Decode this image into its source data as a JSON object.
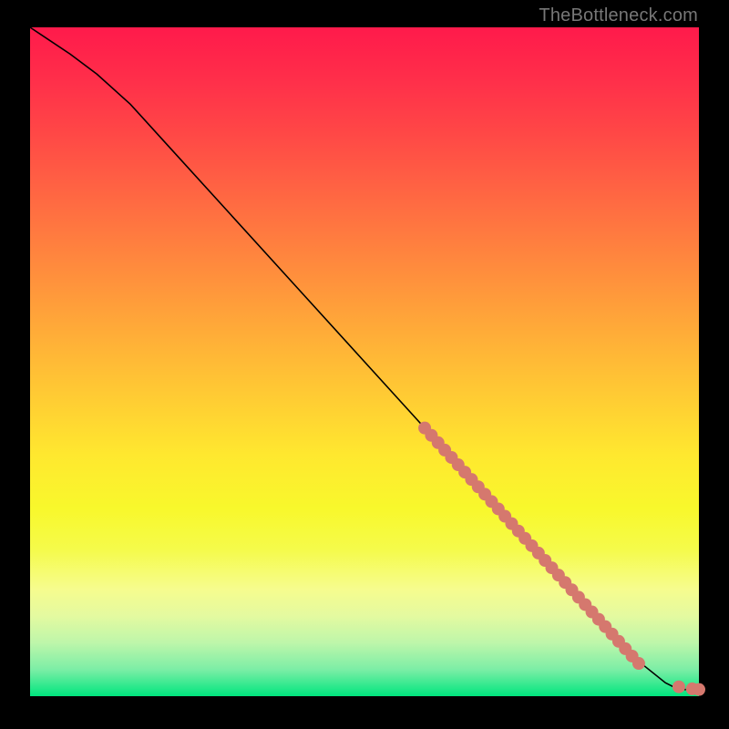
{
  "attribution": "TheBottleneck.com",
  "colors": {
    "dot": "#d5786e",
    "curve": "#000000",
    "page_bg": "#000000"
  },
  "chart_data": {
    "type": "line",
    "title": "",
    "xlabel": "",
    "ylabel": "",
    "xlim": [
      0,
      100
    ],
    "ylim": [
      0,
      100
    ],
    "grid": false,
    "curve": {
      "x": [
        0,
        3,
        6,
        10,
        15,
        20,
        30,
        40,
        50,
        60,
        70,
        80,
        90,
        95,
        97,
        100
      ],
      "y": [
        100,
        98,
        96,
        93,
        88.5,
        83,
        72,
        61,
        50,
        39,
        28,
        17,
        6,
        2,
        1,
        1
      ]
    },
    "series": [
      {
        "name": "points",
        "x": [
          59,
          60,
          61,
          62,
          63,
          64,
          65,
          66,
          67,
          68,
          69,
          70,
          71,
          72,
          73,
          74,
          75,
          76,
          77,
          78,
          79,
          80,
          81,
          82,
          83,
          84,
          85,
          86,
          87,
          88,
          89,
          90,
          91,
          97,
          99,
          100
        ],
        "y": [
          40.1,
          39.0,
          37.9,
          36.8,
          35.7,
          34.6,
          33.5,
          32.4,
          31.3,
          30.2,
          29.1,
          28.0,
          26.9,
          25.8,
          24.7,
          23.6,
          22.5,
          21.4,
          20.3,
          19.2,
          18.1,
          17.0,
          15.9,
          14.8,
          13.7,
          12.6,
          11.5,
          10.4,
          9.3,
          8.2,
          7.1,
          6.0,
          4.9,
          1.4,
          1.1,
          1.0
        ]
      }
    ]
  }
}
